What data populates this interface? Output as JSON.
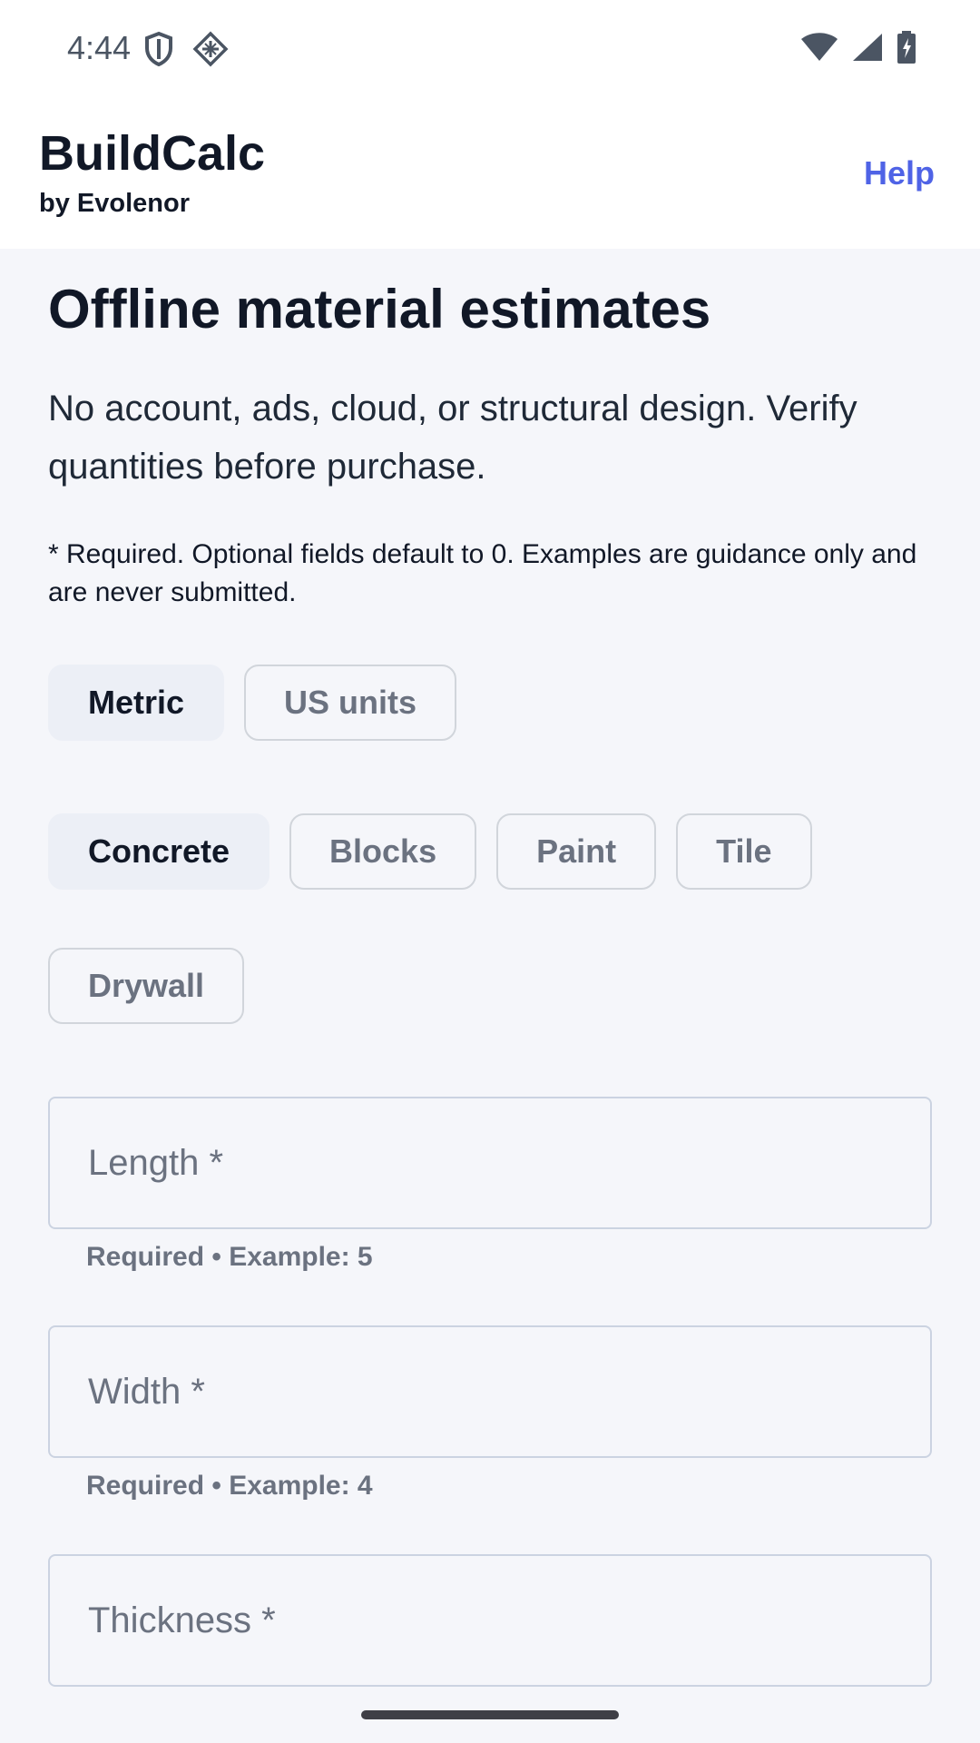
{
  "status": {
    "time": "4:44",
    "left_icons": [
      "shield-icon",
      "diamond-grid-icon"
    ],
    "right_icons": [
      "wifi-icon",
      "signal-icon",
      "battery-icon"
    ]
  },
  "header": {
    "title": "BuildCalc",
    "subtitle": "by Evolenor",
    "help_label": "Help",
    "accent_color": "#4f63e6"
  },
  "main": {
    "title": "Offline material estimates",
    "lead": "No account, ads, cloud, or structural design. Verify quantities before purchase.",
    "note": "* Required. Optional fields default to 0. Examples are guidance only and are never submitted."
  },
  "units": {
    "selected": "Metric",
    "options": [
      {
        "label": "Metric"
      },
      {
        "label": "US units"
      }
    ]
  },
  "calculators": {
    "selected": "Concrete",
    "options": [
      {
        "label": "Concrete"
      },
      {
        "label": "Blocks"
      },
      {
        "label": "Paint"
      },
      {
        "label": "Tile"
      },
      {
        "label": "Drywall"
      }
    ]
  },
  "fields": [
    {
      "placeholder": "Length *",
      "value": "",
      "helper": "Required • Example: 5"
    },
    {
      "placeholder": "Width *",
      "value": "",
      "helper": "Required • Example: 4"
    },
    {
      "placeholder": "Thickness *",
      "value": ""
    }
  ]
}
